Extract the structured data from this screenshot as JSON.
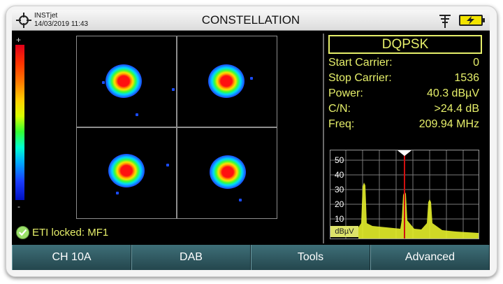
{
  "header": {
    "device_name": "INSTjet",
    "datetime": "14/03/2019 11:43",
    "title": "CONSTELLATION"
  },
  "scale": {
    "top_label": "+",
    "bottom_label": "-"
  },
  "info": {
    "modulation": "DQPSK",
    "rows": [
      {
        "label": "Start Carrier:",
        "value": "0"
      },
      {
        "label": "Stop Carrier:",
        "value": "1536"
      },
      {
        "label": "Power:",
        "value": "40.3 dBµV"
      },
      {
        "label": "C/N:",
        "value": ">24.4 dB"
      },
      {
        "label": "Freq:",
        "value": "209.94 MHz"
      }
    ]
  },
  "spectrum": {
    "y_ticks": [
      "50",
      "40",
      "30",
      "20",
      "10"
    ],
    "unit": "dBµV",
    "marker_color": "#d01010",
    "trace_color": "#e6ef2a"
  },
  "status": {
    "text": "ETI locked: MF1"
  },
  "softkeys": [
    "CH 10A",
    "DAB",
    "Tools",
    "Advanced"
  ],
  "colors": {
    "text_accent": "#e6ef6a",
    "softkey_bg": "#2e5960"
  },
  "icons": {
    "crosshair": "crosshair-icon",
    "antenna": "antenna-icon",
    "battery": "battery-charging-icon",
    "lock": "check-icon"
  }
}
